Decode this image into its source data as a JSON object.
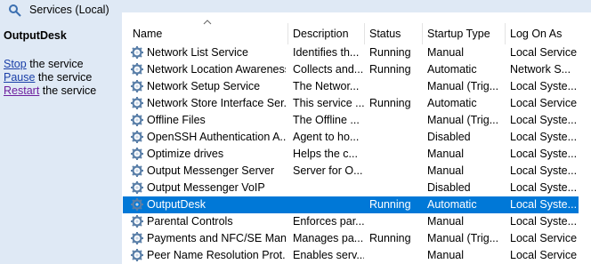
{
  "window": {
    "title": "Services (Local)"
  },
  "detail": {
    "service_name": "OutputDesk",
    "actions": [
      {
        "link": "Stop",
        "rest": " the service"
      },
      {
        "link": "Pause",
        "rest": " the service"
      },
      {
        "link": "Restart",
        "rest": " the service"
      }
    ]
  },
  "columns": [
    "Name",
    "Description",
    "Status",
    "Startup Type",
    "Log On As"
  ],
  "rows": [
    {
      "name": "Network List Service",
      "description": "Identifies th...",
      "status": "Running",
      "startup": "Manual",
      "logon": "Local Service"
    },
    {
      "name": "Network Location Awareness",
      "description": "Collects and...",
      "status": "Running",
      "startup": "Automatic",
      "logon": "Network S..."
    },
    {
      "name": "Network Setup Service",
      "description": "The Networ...",
      "status": "",
      "startup": "Manual (Trig...",
      "logon": "Local Syste..."
    },
    {
      "name": "Network Store Interface Ser...",
      "description": "This service ...",
      "status": "Running",
      "startup": "Automatic",
      "logon": "Local Service"
    },
    {
      "name": "Offline Files",
      "description": "The Offline ...",
      "status": "",
      "startup": "Manual (Trig...",
      "logon": "Local Syste..."
    },
    {
      "name": "OpenSSH Authentication A...",
      "description": "Agent to ho...",
      "status": "",
      "startup": "Disabled",
      "logon": "Local Syste..."
    },
    {
      "name": "Optimize drives",
      "description": "Helps the c...",
      "status": "",
      "startup": "Manual",
      "logon": "Local Syste..."
    },
    {
      "name": "Output Messenger Server",
      "description": "Server for O...",
      "status": "",
      "startup": "Manual",
      "logon": "Local Syste..."
    },
    {
      "name": "Output Messenger VoIP",
      "description": "",
      "status": "",
      "startup": "Disabled",
      "logon": "Local Syste..."
    },
    {
      "name": "OutputDesk",
      "description": "",
      "status": "Running",
      "startup": "Automatic",
      "logon": "Local Syste..."
    },
    {
      "name": "Parental Controls",
      "description": "Enforces par...",
      "status": "",
      "startup": "Manual",
      "logon": "Local Syste..."
    },
    {
      "name": "Payments and NFC/SE Man...",
      "description": "Manages pa...",
      "status": "Running",
      "startup": "Manual (Trig...",
      "logon": "Local Service"
    },
    {
      "name": "Peer Name Resolution Prot...",
      "description": "Enables serv...",
      "status": "",
      "startup": "Manual",
      "logon": "Local Service"
    }
  ],
  "selected_row": 9,
  "colors": {
    "selection": "#0078d7",
    "pane": "#dfe9f5",
    "link": "#1a3fa8",
    "visited_link": "#6e1f9e"
  }
}
